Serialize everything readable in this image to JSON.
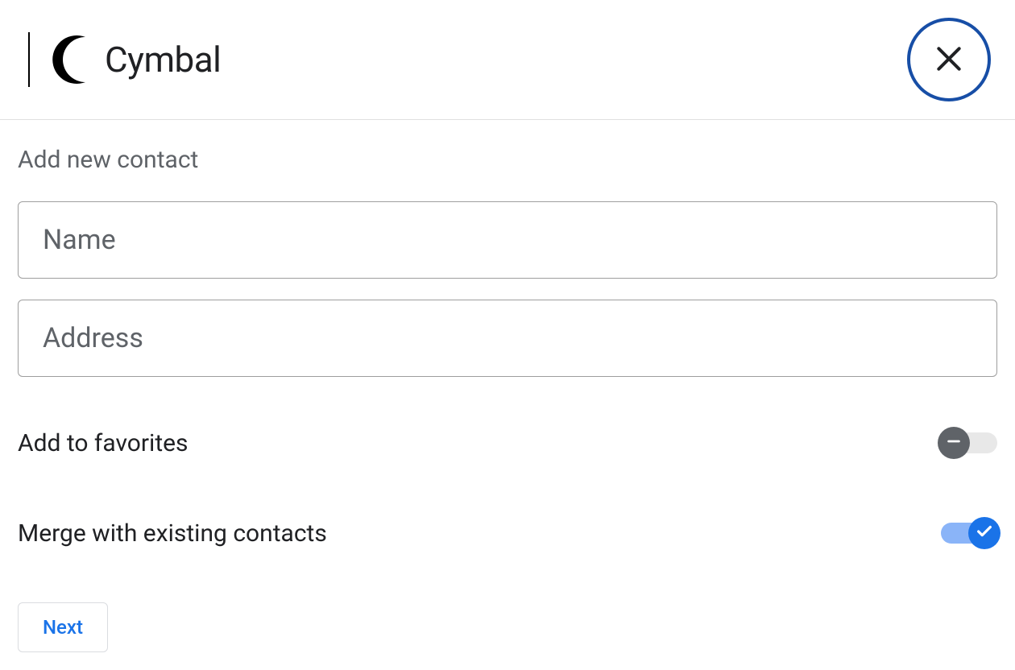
{
  "header": {
    "brand_name": "Cymbal"
  },
  "form": {
    "title": "Add new contact",
    "name_placeholder": "Name",
    "name_value": "",
    "address_placeholder": "Address",
    "address_value": "",
    "favorites_label": "Add to favorites",
    "favorites_on": false,
    "merge_label": "Merge with existing contacts",
    "merge_on": true,
    "next_label": "Next"
  },
  "colors": {
    "accent": "#1a73e8",
    "close_ring": "#174ea6",
    "muted": "#5f6368",
    "border": "#9e9e9e"
  }
}
